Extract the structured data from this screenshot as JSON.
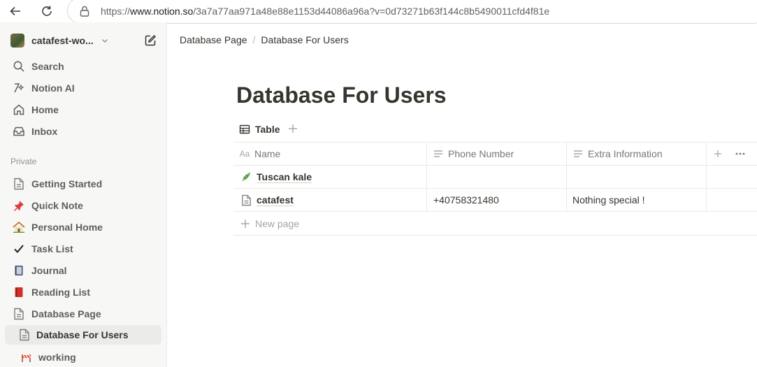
{
  "browser": {
    "url_prefix": "https://",
    "url_host": "www.notion.so",
    "url_path": "/3a7a77aa971a48e88e1153d44086a96a?v=0d73271b63f144c8b5490011cfd4f81e"
  },
  "sidebar": {
    "workspace_name": "catafest-wo...",
    "nav": [
      {
        "label": "Search",
        "icon": "search-icon"
      },
      {
        "label": "Notion AI",
        "icon": "notion-ai-icon"
      },
      {
        "label": "Home",
        "icon": "home-icon"
      },
      {
        "label": "Inbox",
        "icon": "inbox-icon"
      }
    ],
    "section_label": "Private",
    "pages": [
      {
        "label": "Getting Started",
        "icon": "page-icon"
      },
      {
        "label": "Quick Note",
        "icon": "pushpin-icon"
      },
      {
        "label": "Personal Home",
        "icon": "house-icon"
      },
      {
        "label": "Task List",
        "icon": "checkmark-icon"
      },
      {
        "label": "Journal",
        "icon": "notebook-icon"
      },
      {
        "label": "Reading List",
        "icon": "red-book-icon"
      },
      {
        "label": "Database Page",
        "icon": "page-icon"
      },
      {
        "label": "Database For Users",
        "icon": "page-icon",
        "active": true
      },
      {
        "label": "working",
        "icon": "construction-icon"
      }
    ]
  },
  "breadcrumb": [
    "Database Page",
    "/",
    "Database For Users"
  ],
  "page": {
    "title": "Database For Users",
    "view_tab": "Table"
  },
  "table": {
    "headers": [
      {
        "label": "Name",
        "icon": "text-aa-icon"
      },
      {
        "label": "Phone Number",
        "icon": "lines-icon"
      },
      {
        "label": "Extra Information",
        "icon": "lines-icon"
      }
    ],
    "rows": [
      {
        "name": "Tuscan kale",
        "icon": "kale-icon",
        "phone": "",
        "extra": ""
      },
      {
        "name": "catafest",
        "icon": "page-icon",
        "phone": "+40758321480",
        "extra": "Nothing special !"
      }
    ],
    "new_page_label": "New page"
  },
  "colors": {
    "sidebar_bg": "#f7f7f5",
    "active_item_bg": "#ebebea",
    "text": "#37352f",
    "muted": "#787774"
  }
}
